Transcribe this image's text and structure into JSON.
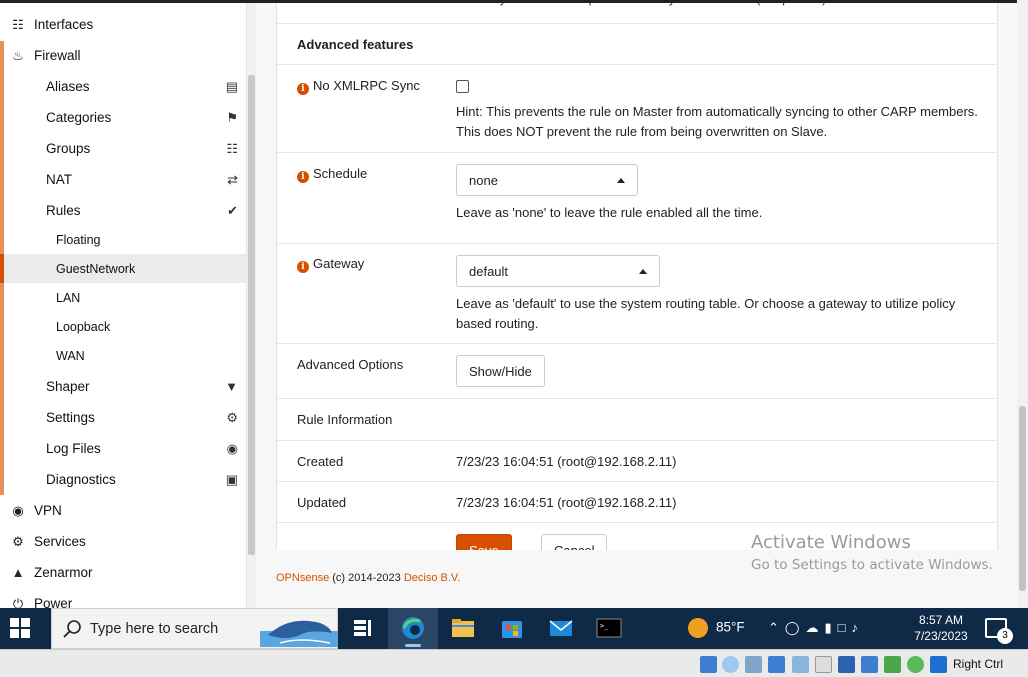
{
  "sidebar": {
    "top_items": [
      {
        "label": "Interfaces",
        "icon": "sitemap-icon"
      },
      {
        "label": "Firewall",
        "icon": "fire-icon"
      }
    ],
    "firewall_items": [
      {
        "label": "Aliases",
        "icon": "list-icon"
      },
      {
        "label": "Categories",
        "icon": "tags-icon"
      },
      {
        "label": "Groups",
        "icon": "sitemap-icon"
      },
      {
        "label": "NAT",
        "icon": "exchange-icon"
      },
      {
        "label": "Rules",
        "icon": "check-icon"
      }
    ],
    "rules_items": [
      "Floating",
      "GuestNetwork",
      "LAN",
      "Loopback",
      "WAN"
    ],
    "firewall_items2": [
      {
        "label": "Shaper",
        "icon": "filter-icon"
      },
      {
        "label": "Settings",
        "icon": "cogs-icon"
      },
      {
        "label": "Log Files",
        "icon": "eye-icon"
      },
      {
        "label": "Diagnostics",
        "icon": "medkit-icon"
      }
    ],
    "bottom_items": [
      {
        "label": "VPN",
        "icon": "globe-icon"
      },
      {
        "label": "Services",
        "icon": "cog-icon"
      },
      {
        "label": "Zenarmor",
        "icon": "binoculars-icon"
      },
      {
        "label": "Power",
        "icon": "power-icon"
      }
    ]
  },
  "form": {
    "description_hint": "You may enter a description here for your reference (not parsed).",
    "advanced_features": "Advanced features",
    "no_xmlrpc": {
      "label": "No XMLRPC Sync",
      "hint1": "Hint: This prevents the rule on Master from automatically syncing to other CARP members.",
      "hint2": "This does NOT prevent the rule from being overwritten on Slave."
    },
    "schedule": {
      "label": "Schedule",
      "value": "none",
      "hint": "Leave as 'none' to leave the rule enabled all the time."
    },
    "gateway": {
      "label": "Gateway",
      "value": "default",
      "hint1": "Leave as 'default' to use the system routing table. Or choose a gateway to utilize policy",
      "hint2": "based routing."
    },
    "advanced_options": {
      "label": "Advanced Options",
      "button": "Show/Hide"
    },
    "rule_information": "Rule Information",
    "created": {
      "label": "Created",
      "value": "7/23/23 16:04:51 (root@192.168.2.11)"
    },
    "updated": {
      "label": "Updated",
      "value": "7/23/23 16:04:51 (root@192.168.2.11)"
    },
    "save": "Save",
    "cancel": "Cancel"
  },
  "footer": {
    "brand": "OPNsense",
    "middle": " (c) 2014-2023 ",
    "company": "Deciso B.V."
  },
  "watermark": {
    "line1": "Activate Windows",
    "line2": "Go to Settings to activate Windows."
  },
  "taskbar": {
    "search_placeholder": "Type here to search",
    "temperature": "85°F",
    "time": "8:57 AM",
    "date": "7/23/2023",
    "notification_count": "3"
  },
  "vbox": {
    "host_key": "Right Ctrl"
  }
}
